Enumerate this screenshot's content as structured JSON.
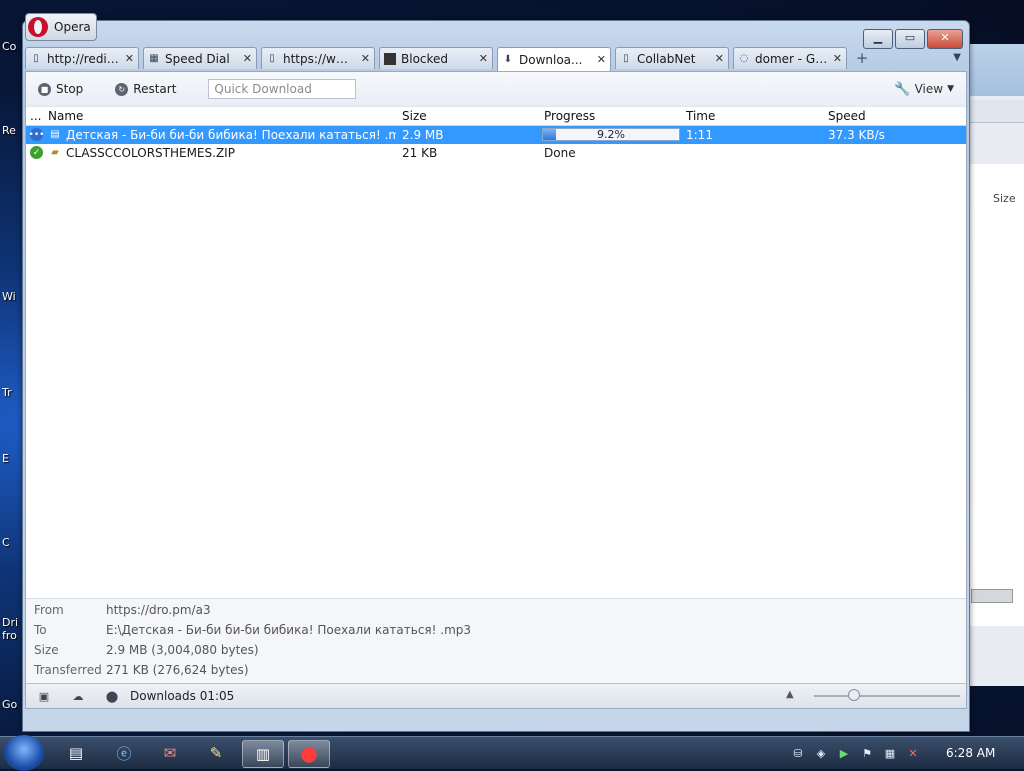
{
  "window": {
    "app_title": "Opera"
  },
  "tabs": [
    {
      "label": "http://redir...",
      "icon": "page-icon"
    },
    {
      "label": "Speed Dial",
      "icon": "grid-icon"
    },
    {
      "label": "https://www...",
      "icon": "page-icon"
    },
    {
      "label": "Blocked",
      "icon": "blocked-thumb-icon"
    },
    {
      "label": "Downloa...",
      "icon": "download-icon",
      "active": true
    },
    {
      "label": "CollabNet",
      "icon": "page-icon"
    },
    {
      "label": "domer - Go...",
      "icon": "loading-icon"
    }
  ],
  "toolbar": {
    "stop_label": "Stop",
    "restart_label": "Restart",
    "quick_download_placeholder": "Quick Download",
    "view_label": "View"
  },
  "columns": {
    "menu": "...",
    "name": "Name",
    "size": "Size",
    "progress": "Progress",
    "time": "Time",
    "speed": "Speed"
  },
  "downloads": [
    {
      "name": "Детская - Би-би би-би бибика! Поехали кататься! .mp3",
      "size": "2.9 MB",
      "progress_text": "9.2%",
      "progress_fraction": 0.092,
      "time": "1:11",
      "speed": "37.3 KB/s",
      "selected": true
    },
    {
      "name": "CLASSCCOLORSTHEMES.ZIP",
      "size": "21 KB",
      "progress_text": "Done",
      "time": "",
      "speed": "",
      "selected": false
    }
  ],
  "details": {
    "from_label": "From",
    "from_value": "https://dro.pm/a3",
    "to_label": "To",
    "to_value": "E:\\Детская - Би-би би-би бибика! Поехали кататься! .mp3",
    "size_label": "Size",
    "size_value": "2.9 MB (3,004,080 bytes)",
    "transferred_label": "Transferred",
    "transferred_value": "271 KB (276,624 bytes)"
  },
  "status": {
    "downloads_text": "Downloads 01:05"
  },
  "taskbar": {
    "clock": "6:28 AM"
  },
  "background_window": {
    "size_header": "Size"
  },
  "colors": {
    "selection": "#3399ff",
    "close_button": "#c94b36"
  }
}
